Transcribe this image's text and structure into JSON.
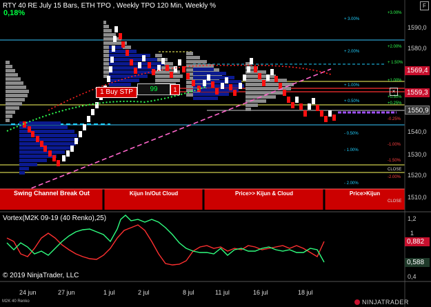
{
  "header": {
    "title": "RTY 40 RE July 15 Bars, ETH TPO , Weekly TPO 120 Min, Weekly %",
    "percent_change": "0,18%",
    "window_button": "F"
  },
  "price_axis": {
    "labels": [
      "1590,0",
      "1580,0",
      "1550,0",
      "1540,0",
      "1530,0",
      "1520,0",
      "1510,0"
    ],
    "badges": [
      {
        "value": "1569,4",
        "color": "#c8102e"
      },
      {
        "value": "1559,3",
        "color": "#c8102e"
      },
      {
        "value": "1550,9",
        "color": "#333333"
      }
    ]
  },
  "weekly_pct_labels": {
    "cyan": [
      "+ 3.00%",
      "+ 2.00%",
      "+ 1.00%",
      "+ 0.50%",
      "- 0.50%",
      "- 1.00%",
      "- 2.00%"
    ],
    "right": [
      "+3.00%",
      "+2.00%",
      "+ 1.50%",
      "+1.00%",
      "+0.50%",
      "+0.25%",
      "-0.25%",
      "-1.00%",
      "-1.50%",
      "-2.00%",
      "CLOSE",
      "CLOSE"
    ]
  },
  "order": {
    "buy_label": "1 Buy STP",
    "quantity": "99",
    "cancel_label": "1",
    "close_x": "×"
  },
  "banner": {
    "items": [
      "Swing Channel Break Out",
      "Kijun In/Out Cloud",
      "Price>> Kijun & Cloud",
      "Price>Kijun",
      ""
    ]
  },
  "vortex": {
    "title": "Vortex(M2K 09-19 (40 Renko),25)",
    "axis": [
      "1,2",
      "1",
      "0,6",
      "0,4"
    ],
    "badges": [
      {
        "value": "0,882",
        "color": "#c8102e"
      },
      {
        "value": "0,588",
        "color": "#1f3a2a"
      }
    ],
    "vi_plus_color": "#ff3030",
    "vi_minus_color": "#30ff80"
  },
  "x_axis": {
    "labels": [
      "24 jun",
      "27 jun",
      "1 jul",
      "2 jul",
      "8 jul",
      "11 jul",
      "16 jul",
      "18 jul"
    ]
  },
  "footer": {
    "copyright": "© 2019 NinjaTrader, LLC",
    "symbol": "M2K 40 Renko",
    "logo": "NINJATRADER"
  },
  "colors": {
    "bull_brick": "#ffffff",
    "bear_brick": "#ff1010",
    "tpo_gray": "#8c8c8c",
    "tpo_blue": "#0b1a8f",
    "accent_red": "#c8102e",
    "cyan": "#20d0ff",
    "yellow": "#ffff60"
  }
}
